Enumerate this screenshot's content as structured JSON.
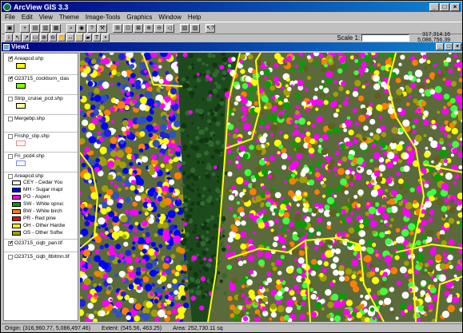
{
  "app": {
    "title": "ArcView GIS 3.3"
  },
  "menu": [
    "File",
    "Edit",
    "View",
    "Theme",
    "Image-Tools",
    "Graphics",
    "Window",
    "Help"
  ],
  "scale": {
    "label": "Scale 1:",
    "value": ""
  },
  "coords": {
    "x": "317,314.16",
    "y": "5,086,756.39"
  },
  "view": {
    "title": "View1"
  },
  "themes": [
    {
      "name": "Areapcd.shp",
      "checked": true,
      "swatch": "#ffff00"
    },
    {
      "name": "O23715_cockburn_clas",
      "checked": true,
      "swatch": "#80ff00"
    },
    {
      "name": "Strip_cruise_pcd.shp",
      "checked": false,
      "swatch": "#ffff99"
    },
    {
      "name": "Mergebp.shp",
      "checked": false
    },
    {
      "name": "Frishp_clip.shp",
      "checked": false,
      "swatch": "#ff8080"
    },
    {
      "name": "Fri_pcd4.shp",
      "checked": false,
      "swatch": "#8080ff"
    },
    {
      "name": "Areapcd.shp",
      "checked": false
    },
    {
      "name": "O23715_ciqb_pan.tif",
      "checked": true
    },
    {
      "name": "O23715_ciqb_8bitmn.tif",
      "checked": false
    }
  ],
  "legend": [
    {
      "label": "CEY - Cedar You",
      "color": "#ffffff"
    },
    {
      "label": "MH - Sugar mapl",
      "color": "#0000ff"
    },
    {
      "label": "PO - Aspen",
      "color": "#ff00ff"
    },
    {
      "label": "SW - White spruc",
      "color": "#00a000"
    },
    {
      "label": "BW - White birch",
      "color": "#ff8000"
    },
    {
      "label": "PR - Red pine",
      "color": "#ff0000"
    },
    {
      "label": "OH - Other Hardw",
      "color": "#ffff00"
    },
    {
      "label": "OS - Other Softw",
      "color": "#a0a000"
    }
  ],
  "status": {
    "origin": "Origin: (316,960.77, 5,086,497.46)",
    "extent": "Extent: (545.56, 463.25)",
    "area": "Area: 252,730.11 sq"
  },
  "colors": {
    "title": "#000080",
    "outline": "#ffff00"
  }
}
